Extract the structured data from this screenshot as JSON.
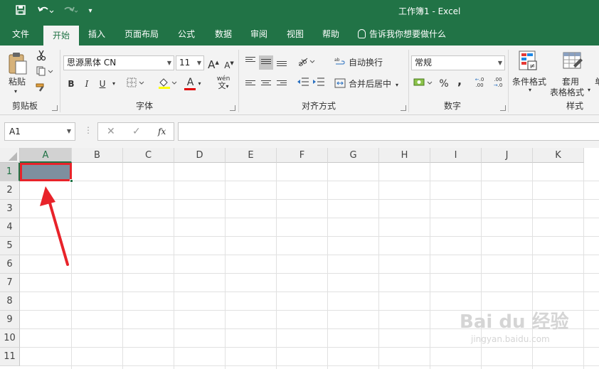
{
  "app": {
    "document_title": "工作簿1  -   Excel"
  },
  "quick_access": {
    "save_icon": "save-icon",
    "undo_icon": "undo-icon",
    "redo_icon": "redo-icon",
    "customize_icon": "customize-qat-icon"
  },
  "tabs": [
    {
      "label": "文件"
    },
    {
      "label": "开始"
    },
    {
      "label": "插入"
    },
    {
      "label": "页面布局"
    },
    {
      "label": "公式"
    },
    {
      "label": "数据"
    },
    {
      "label": "审阅"
    },
    {
      "label": "视图"
    },
    {
      "label": "帮助"
    }
  ],
  "tell_me": "告诉我你想要做什么",
  "ribbon": {
    "clipboard": {
      "label": "剪贴板",
      "paste": "粘贴"
    },
    "font": {
      "label": "字体",
      "font_name": "思源黑体 CN",
      "font_size": "11",
      "bold": "B",
      "italic": "I",
      "underline": "U",
      "grow": "A",
      "shrink": "A",
      "font_color": "A",
      "phonetic": "wén"
    },
    "alignment": {
      "label": "对齐方式",
      "wrap_text": "自动换行",
      "merge_center": "合并后居中"
    },
    "number": {
      "label": "数字",
      "format": "常规",
      "percent": "%",
      "comma": ","
    },
    "styles": {
      "label": "样式",
      "conditional": "条件格式",
      "table_format_1": "套用",
      "table_format_2": "表格格式",
      "cell_styles_partial": "单"
    }
  },
  "formula_bar": {
    "name_box": "A1",
    "cancel": "✕",
    "enter": "✓",
    "fx": "fx",
    "value": ""
  },
  "grid": {
    "columns": [
      "A",
      "B",
      "C",
      "D",
      "E",
      "F",
      "G",
      "H",
      "I",
      "J",
      "K"
    ],
    "rows": [
      "1",
      "2",
      "3",
      "4",
      "5",
      "6",
      "7",
      "8",
      "9",
      "10",
      "11"
    ],
    "selected_cell": "A1",
    "selected_fill": "#7e8f9f",
    "highlight_color": "#e8232a",
    "accent": "#217346"
  },
  "watermark": {
    "logo": "Bai du 经验",
    "url": "jingyan.baidu.com"
  }
}
